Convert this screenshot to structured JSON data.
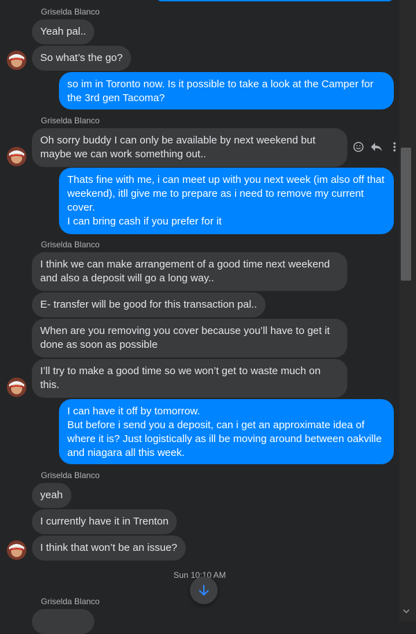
{
  "sender_name": "Griselda Blanco",
  "messages": [
    {
      "text": "Yeah pal.."
    },
    {
      "text": "So what’s the go?"
    },
    {
      "text": "so im in Toronto now. Is it possible to take a look at the Camper for the 3rd gen Tacoma?"
    },
    {
      "text": "Oh sorry buddy I can only be available by next weekend but maybe we can work something out.."
    },
    {
      "text": "Thats fine with me, i can meet up with you next week (im also off that weekend), itll give me to prepare as i need to remove my current cover.\nI can bring cash if you prefer for it"
    },
    {
      "text": "I think we can make arrangement of a good time next weekend and also a deposit will go a long way.."
    },
    {
      "text": "E- transfer will be good for this transaction pal.."
    },
    {
      "text": "When are you removing you cover because you’ll have to get it done as soon as possible"
    },
    {
      "text": "I’ll try to make a good time so we won’t get to waste much on this."
    },
    {
      "text": "I can have it off by tomorrow.\nBut before i send you a deposit, can i get an approximate idea of where it is? Just logistically as ill be moving around between oakville and niagara all this week."
    },
    {
      "text": "yeah"
    },
    {
      "text": "I currently have it in Trenton"
    },
    {
      "text": "I think that won’t be an issue?"
    }
  ],
  "timestamp": "Sun 10:10 AM",
  "colors": {
    "background": "#242526",
    "incoming_bubble": "#3a3b3c",
    "outgoing_bubble": "#0084ff",
    "accent": "#2d88ff"
  },
  "icons": {
    "react": "smiley-icon",
    "reply": "reply-icon",
    "more": "more-vertical-icon",
    "scroll_down": "arrow-down-icon"
  }
}
